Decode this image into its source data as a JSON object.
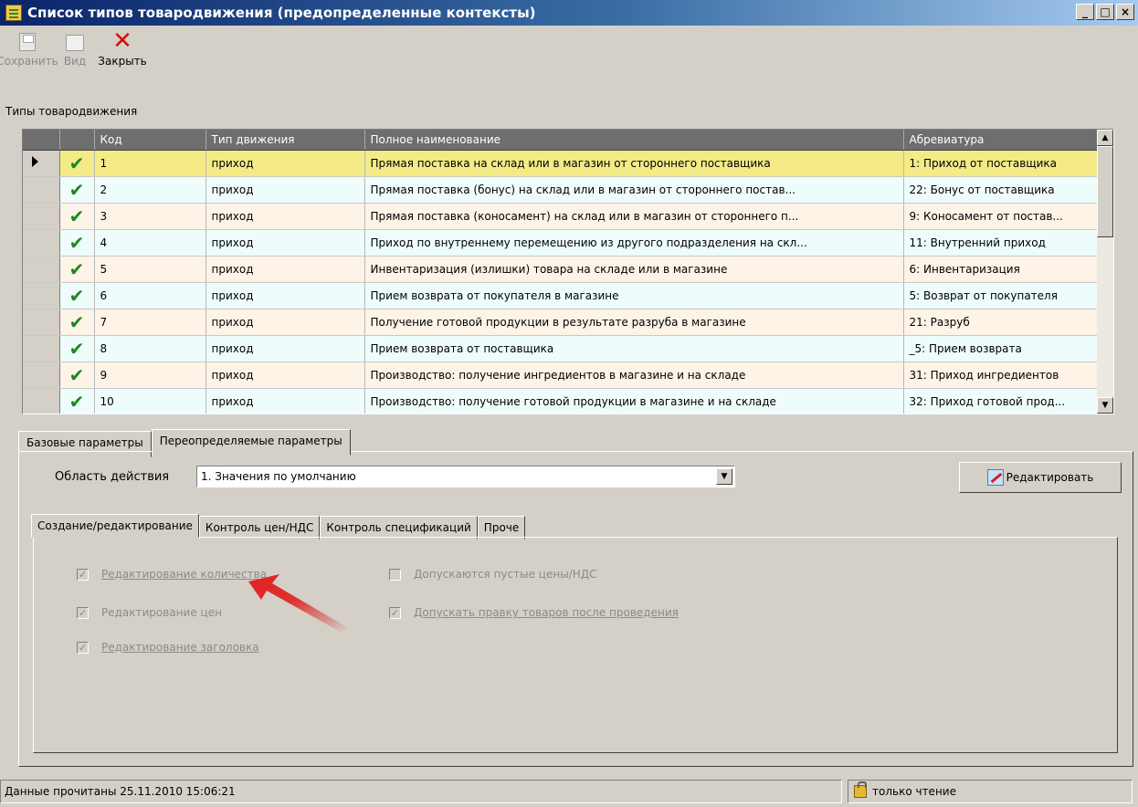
{
  "window": {
    "title": "Список типов товародвижения (предопределенные контексты)",
    "buttons": {
      "minimize": "_",
      "maximize": "□",
      "close": "×"
    }
  },
  "toolbar": {
    "save_label": "Сохранить",
    "view_label": "Вид",
    "close_label": "Закрыть"
  },
  "grid": {
    "section_label": "Типы товародвижения",
    "columns": [
      "Код",
      "Тип движения",
      "Полное наименование",
      "Абревиатура"
    ],
    "rows": [
      {
        "code": "1",
        "type": "приход",
        "name": "Прямая поставка на склад или в магазин от стороннего поставщика",
        "abbr": "1: Приход от поставщика"
      },
      {
        "code": "2",
        "type": "приход",
        "name": "Прямая поставка (бонус) на склад или в магазин от стороннего постав...",
        "abbr": "22: Бонус от поставщика"
      },
      {
        "code": "3",
        "type": "приход",
        "name": "Прямая поставка (коносамент) на склад или в магазин от стороннего п...",
        "abbr": "9: Коносамент от постав..."
      },
      {
        "code": "4",
        "type": "приход",
        "name": "Приход по внутреннему перемещению из другого подразделения на скл...",
        "abbr": "11: Внутренний приход"
      },
      {
        "code": "5",
        "type": "приход",
        "name": "Инвентаризация (излишки) товара на складе или в магазине",
        "abbr": "6: Инвентаризация"
      },
      {
        "code": "6",
        "type": "приход",
        "name": "Прием возврата от покупателя в магазине",
        "abbr": "5: Возврат от покупателя"
      },
      {
        "code": "7",
        "type": "приход",
        "name": "Получение готовой продукции в результате разруба в магазине",
        "abbr": "21: Разруб"
      },
      {
        "code": "8",
        "type": "приход",
        "name": "Прием возврата от поставщика",
        "abbr": "_5: Прием возврата"
      },
      {
        "code": "9",
        "type": "приход",
        "name": "Производство: получение ингредиентов в магазине и на складе",
        "abbr": "31: Приход ингредиентов"
      },
      {
        "code": "10",
        "type": "приход",
        "name": "Производство: получение готовой продукции в магазине и на складе",
        "abbr": "32: Приход готовой прод..."
      }
    ]
  },
  "tabs": {
    "outer": [
      "Базовые параметры",
      "Переопределяемые параметры"
    ],
    "inner": [
      "Создание/редактирование",
      "Контроль цен/НДС",
      "Контроль спецификаций",
      "Проче"
    ]
  },
  "scope": {
    "label": "Область действия",
    "value": "1. Значения по умолчанию"
  },
  "edit_button": "Редактировать",
  "options": {
    "edit_qty": {
      "label": "Редактирование количества",
      "checked": true
    },
    "edit_price": {
      "label": "Редактирование цен",
      "checked": true
    },
    "edit_header": {
      "label": "Редактирование заголовка",
      "checked": true
    },
    "empty_prices": {
      "label": "Допускаются пустые цены/НДС",
      "checked": false
    },
    "edit_after_post": {
      "label": "Допускать правку товаров после проведения",
      "checked": true
    }
  },
  "status": {
    "message": "Данные прочитаны 25.11.2010 15:06:21",
    "mode": "только чтение"
  },
  "colors": {
    "selected_row": "#f4ea86",
    "row_odd": "#fdf3e6",
    "row_even": "#eefdfb",
    "header_bg": "#6e6e6e",
    "annotation_arrow": "#e02020"
  }
}
